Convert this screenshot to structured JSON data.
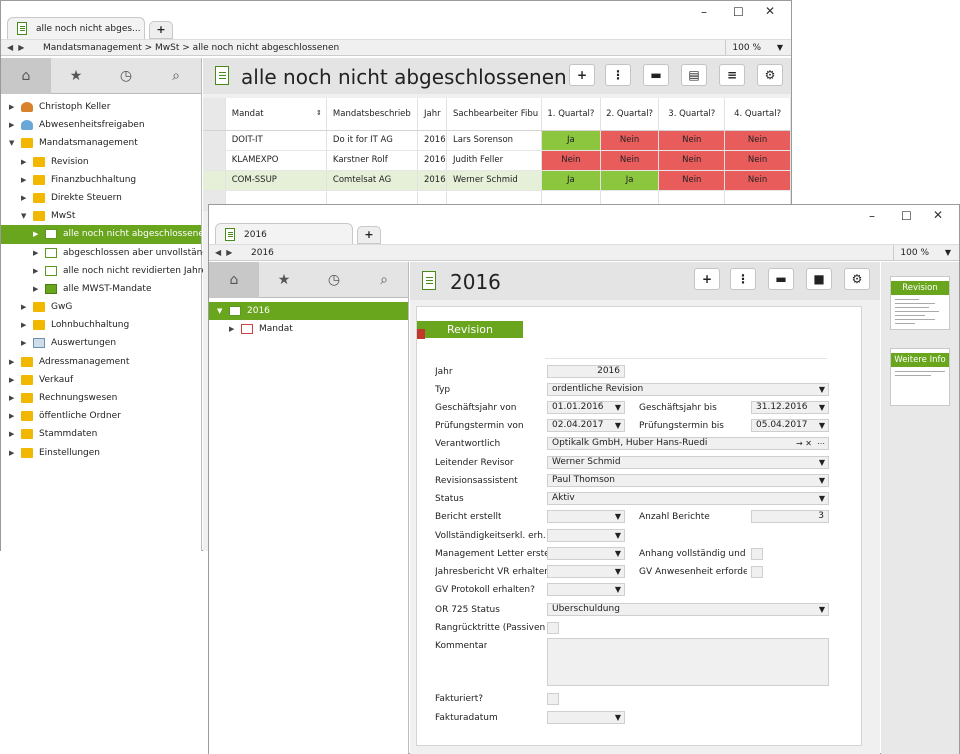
{
  "window1": {
    "tab_title": "alle noch nicht abges...",
    "breadcrumb": "Mandatsmanagement  >  MwSt  >  alle noch nicht abgeschlossenen",
    "zoom": "100 %",
    "title": "alle noch nicht abgeschlossenen",
    "tree": [
      {
        "label": "Christoph Keller",
        "level": 0,
        "icon": "user-icon"
      },
      {
        "label": "Abwesenheitsfreigaben",
        "level": 0,
        "icon": "user-icon"
      },
      {
        "label": "Mandatsmanagement",
        "level": 0,
        "icon": "folder-icon",
        "expanded": true
      },
      {
        "label": "Revision",
        "level": 1,
        "icon": "folder-icon"
      },
      {
        "label": "Finanzbuchhaltung",
        "level": 1,
        "icon": "folder-icon"
      },
      {
        "label": "Direkte Steuern",
        "level": 1,
        "icon": "folder-icon"
      },
      {
        "label": "MwSt",
        "level": 1,
        "icon": "folder-icon",
        "expanded": true
      },
      {
        "label": "alle noch nicht abgeschlossenen",
        "level": 2,
        "icon": "document-icon",
        "selected": true
      },
      {
        "label": "abgeschlossen aber unvollständig",
        "level": 2,
        "icon": "document-icon"
      },
      {
        "label": "alle noch nicht revidierten Jahre",
        "level": 2,
        "icon": "document-icon"
      },
      {
        "label": "alle MWST-Mandate",
        "level": 2,
        "icon": "table-icon"
      },
      {
        "label": "GwG",
        "level": 1,
        "icon": "folder-icon"
      },
      {
        "label": "Lohnbuchhaltung",
        "level": 1,
        "icon": "folder-icon"
      },
      {
        "label": "Auswertungen",
        "level": 1,
        "icon": "chart-icon"
      },
      {
        "label": "Adressmanagement",
        "level": 0,
        "icon": "folder-icon"
      },
      {
        "label": "Verkauf",
        "level": 0,
        "icon": "folder-icon"
      },
      {
        "label": "Rechnungswesen",
        "level": 0,
        "icon": "folder-icon"
      },
      {
        "label": "öffentliche Ordner",
        "level": 0,
        "icon": "folder-icon"
      },
      {
        "label": "Stammdaten",
        "level": 0,
        "icon": "folder-icon"
      },
      {
        "label": "Einstellungen",
        "level": 0,
        "icon": "settings-folder-icon"
      }
    ],
    "table": {
      "columns": [
        "Mandat",
        "Mandatsbeschrieb",
        "Jahr",
        "Sachbearbeiter Fibu",
        "1. Quartal?",
        "2. Quartal?",
        "3. Quartal?",
        "4. Quartal?"
      ],
      "rows": [
        {
          "mandat": "DOIT-IT",
          "beschrieb": "Do it for IT AG",
          "jahr": "2016",
          "sachbearbeiter": "Lars Sorenson",
          "q": [
            "Ja",
            "Nein",
            "Nein",
            "Nein"
          ]
        },
        {
          "mandat": "KLAMEXPO",
          "beschrieb": "Karstner Rolf",
          "jahr": "2016",
          "sachbearbeiter": "Judith Feller",
          "q": [
            "Nein",
            "Nein",
            "Nein",
            "Nein"
          ]
        },
        {
          "mandat": "COM-SSUP",
          "beschrieb": "Comtelsat AG",
          "jahr": "2016",
          "sachbearbeiter": "Werner Schmid",
          "q": [
            "Ja",
            "Ja",
            "Nein",
            "Nein"
          ]
        }
      ]
    }
  },
  "window2": {
    "tab_title": "2016",
    "breadcrumb": "2016",
    "zoom": "100 %",
    "title": "2016",
    "tree": [
      {
        "label": "2016",
        "selected": true
      },
      {
        "label": "Mandat"
      }
    ],
    "section_title": "Revision",
    "cards": [
      "Revision",
      "Weitere Info"
    ],
    "form": {
      "jahr_label": "Jahr",
      "jahr_value": "2016",
      "typ_label": "Typ",
      "typ_value": "ordentliche Revision",
      "gj_von_label": "Geschäftsjahr von",
      "gj_von_value": "01.01.2016",
      "gj_bis_label": "Geschäftsjahr bis",
      "gj_bis_value": "31.12.2016",
      "pt_von_label": "Prüfungstermin von",
      "pt_von_value": "02.04.2017",
      "pt_bis_label": "Prüfungstermin bis",
      "pt_bis_value": "05.04.2017",
      "verantwortlich_label": "Verantwortlich",
      "verantwortlich_value": "Optikalk GmbH, Huber Hans-Ruedi",
      "revisor_label": "Leitender Revisor",
      "revisor_value": "Werner Schmid",
      "assistent_label": "Revisionsassistent",
      "assistent_value": "Paul Thomson",
      "status_label": "Status",
      "status_value": "Aktiv",
      "bericht_label": "Bericht erstellt",
      "anzahl_label": "Anzahl Berichte",
      "anzahl_value": "3",
      "vollst_label": "Vollständigkeitserkl. erh.",
      "mgmt_label": "Management Letter erstellt",
      "anhang_label": "Anhang vollständig und ri...",
      "jahresbericht_label": "Jahresbericht VR erhalten",
      "gv_anw_label": "GV Anwesenheit erforderli...",
      "gv_prot_label": "GV Protokoll erhalten?",
      "or725_label": "OR 725 Status",
      "or725_value": "Überschuldung",
      "rang_label": "Rangrücktritte (Passiven) v...",
      "kommentar_label": "Kommentar",
      "fakturiert_label": "Fakturiert?",
      "fakturadatum_label": "Fakturadatum"
    }
  }
}
